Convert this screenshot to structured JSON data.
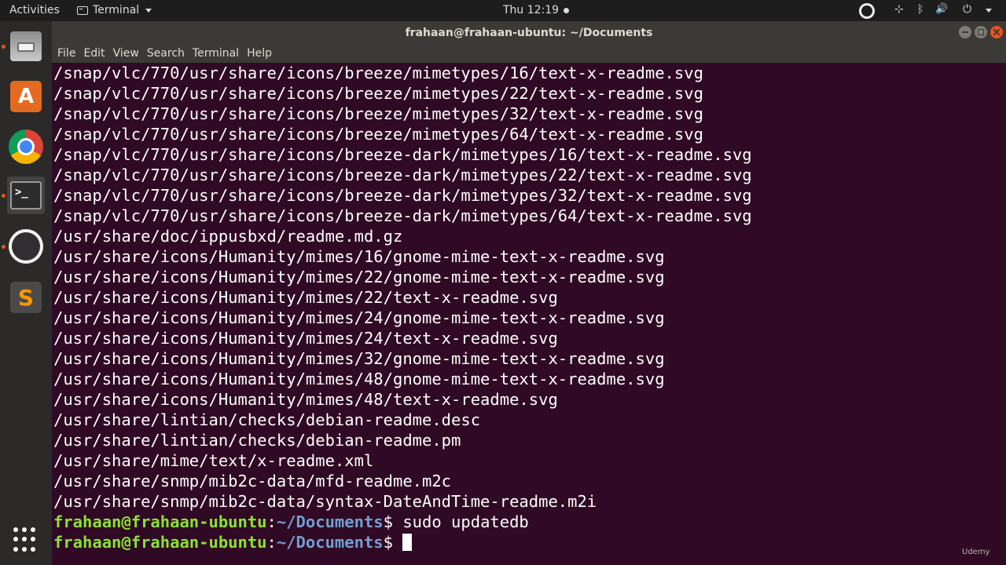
{
  "topbar": {
    "activities": "Activities",
    "app_name": "Terminal",
    "clock": "Thu 12:19",
    "network_glyph": "⊹",
    "bluetooth_glyph": "ᛒ",
    "volume_glyph": "🔊",
    "power_glyph": "⏻"
  },
  "launcher": {
    "items": [
      "Files",
      "Ubuntu Software",
      "Google Chrome",
      "Terminal",
      "OBS Studio",
      "Sublime Text"
    ],
    "terminal_glyph": ">_",
    "software_glyph": "A",
    "sublime_glyph": "S"
  },
  "window": {
    "title": "frahaan@frahaan-ubuntu: ~/Documents",
    "menu": [
      "File",
      "Edit",
      "View",
      "Search",
      "Terminal",
      "Help"
    ]
  },
  "terminal": {
    "output_lines": [
      "/snap/vlc/770/usr/share/icons/breeze/mimetypes/16/text-x-readme.svg",
      "/snap/vlc/770/usr/share/icons/breeze/mimetypes/22/text-x-readme.svg",
      "/snap/vlc/770/usr/share/icons/breeze/mimetypes/32/text-x-readme.svg",
      "/snap/vlc/770/usr/share/icons/breeze/mimetypes/64/text-x-readme.svg",
      "/snap/vlc/770/usr/share/icons/breeze-dark/mimetypes/16/text-x-readme.svg",
      "/snap/vlc/770/usr/share/icons/breeze-dark/mimetypes/22/text-x-readme.svg",
      "/snap/vlc/770/usr/share/icons/breeze-dark/mimetypes/32/text-x-readme.svg",
      "/snap/vlc/770/usr/share/icons/breeze-dark/mimetypes/64/text-x-readme.svg",
      "/usr/share/doc/ippusbxd/readme.md.gz",
      "/usr/share/icons/Humanity/mimes/16/gnome-mime-text-x-readme.svg",
      "/usr/share/icons/Humanity/mimes/22/gnome-mime-text-x-readme.svg",
      "/usr/share/icons/Humanity/mimes/22/text-x-readme.svg",
      "/usr/share/icons/Humanity/mimes/24/gnome-mime-text-x-readme.svg",
      "/usr/share/icons/Humanity/mimes/24/text-x-readme.svg",
      "/usr/share/icons/Humanity/mimes/32/gnome-mime-text-x-readme.svg",
      "/usr/share/icons/Humanity/mimes/48/gnome-mime-text-x-readme.svg",
      "/usr/share/icons/Humanity/mimes/48/text-x-readme.svg",
      "/usr/share/lintian/checks/debian-readme.desc",
      "/usr/share/lintian/checks/debian-readme.pm",
      "/usr/share/mime/text/x-readme.xml",
      "/usr/share/snmp/mib2c-data/mfd-readme.m2c",
      "/usr/share/snmp/mib2c-data/syntax-DateAndTime-readme.m2i"
    ],
    "prompt_user": "frahaan@frahaan-ubuntu",
    "prompt_sep": ":",
    "prompt_path": "~/Documents",
    "prompt_symbol": "$",
    "previous_command": " sudo updatedb",
    "current_command": " "
  },
  "watermark": "Udemy",
  "colors": {
    "terminal_bg": "#300a24",
    "prompt_user": "#8ae234",
    "prompt_path": "#729fcf",
    "close_button": "#e9541f"
  }
}
